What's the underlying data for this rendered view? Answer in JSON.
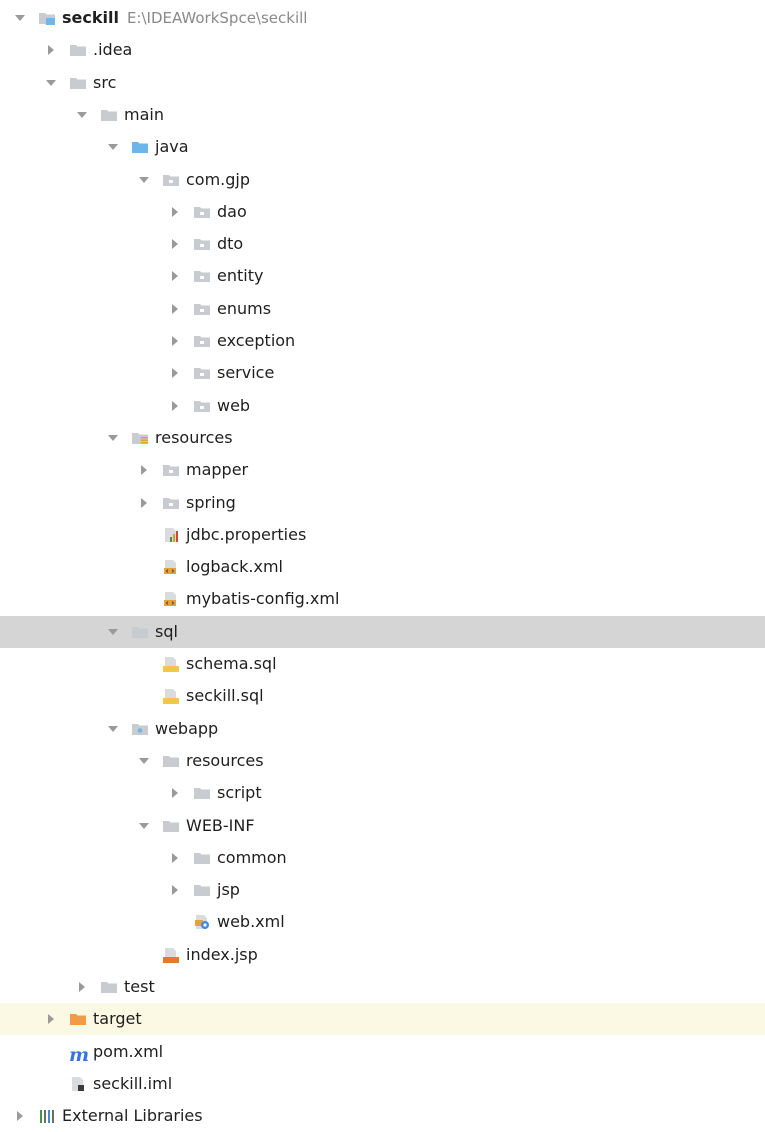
{
  "tree": {
    "root": {
      "name": "seckill",
      "path": "E:\\IDEAWorkSpce\\seckill"
    },
    "items": [
      {
        "label": "seckill",
        "level": 0,
        "arrow": "down",
        "icon": "module-folder-icon",
        "root": true
      },
      {
        "label": ".idea",
        "level": 1,
        "arrow": "right",
        "icon": "folder-icon"
      },
      {
        "label": "src",
        "level": 1,
        "arrow": "down",
        "icon": "folder-icon"
      },
      {
        "label": "main",
        "level": 2,
        "arrow": "down",
        "icon": "folder-icon"
      },
      {
        "label": "java",
        "level": 3,
        "arrow": "down",
        "icon": "source-folder-icon"
      },
      {
        "label": "com.gjp",
        "level": 4,
        "arrow": "down",
        "icon": "package-icon"
      },
      {
        "label": "dao",
        "level": 5,
        "arrow": "right",
        "icon": "package-icon"
      },
      {
        "label": "dto",
        "level": 5,
        "arrow": "right",
        "icon": "package-icon"
      },
      {
        "label": "entity",
        "level": 5,
        "arrow": "right",
        "icon": "package-icon"
      },
      {
        "label": "enums",
        "level": 5,
        "arrow": "right",
        "icon": "package-icon"
      },
      {
        "label": "exception",
        "level": 5,
        "arrow": "right",
        "icon": "package-icon"
      },
      {
        "label": "service",
        "level": 5,
        "arrow": "right",
        "icon": "package-icon"
      },
      {
        "label": "web",
        "level": 5,
        "arrow": "right",
        "icon": "package-icon"
      },
      {
        "label": "resources",
        "level": 3,
        "arrow": "down",
        "icon": "resources-folder-icon"
      },
      {
        "label": "mapper",
        "level": 4,
        "arrow": "right",
        "icon": "package-icon"
      },
      {
        "label": "spring",
        "level": 4,
        "arrow": "right",
        "icon": "package-icon"
      },
      {
        "label": "jdbc.properties",
        "level": 4,
        "arrow": "none",
        "icon": "properties-file-icon"
      },
      {
        "label": "logback.xml",
        "level": 4,
        "arrow": "none",
        "icon": "xml-file-icon"
      },
      {
        "label": "mybatis-config.xml",
        "level": 4,
        "arrow": "none",
        "icon": "xml-file-icon"
      },
      {
        "label": "sql",
        "level": 3,
        "arrow": "down",
        "icon": "folder-icon",
        "selected": true
      },
      {
        "label": "schema.sql",
        "level": 4,
        "arrow": "none",
        "icon": "sql-file-icon"
      },
      {
        "label": "seckill.sql",
        "level": 4,
        "arrow": "none",
        "icon": "sql-file-icon"
      },
      {
        "label": "webapp",
        "level": 3,
        "arrow": "down",
        "icon": "web-folder-icon"
      },
      {
        "label": "resources",
        "level": 4,
        "arrow": "down",
        "icon": "folder-icon"
      },
      {
        "label": "script",
        "level": 5,
        "arrow": "right",
        "icon": "folder-icon"
      },
      {
        "label": "WEB-INF",
        "level": 4,
        "arrow": "down",
        "icon": "folder-icon"
      },
      {
        "label": "common",
        "level": 5,
        "arrow": "right",
        "icon": "folder-icon"
      },
      {
        "label": "jsp",
        "level": 5,
        "arrow": "right",
        "icon": "folder-icon"
      },
      {
        "label": "web.xml",
        "level": 5,
        "arrow": "none",
        "icon": "webxml-file-icon"
      },
      {
        "label": "index.jsp",
        "level": 4,
        "arrow": "none",
        "icon": "jsp-file-icon"
      },
      {
        "label": "test",
        "level": 2,
        "arrow": "right",
        "icon": "folder-icon"
      },
      {
        "label": "target",
        "level": 1,
        "arrow": "right",
        "icon": "excluded-folder-icon",
        "highlight": true
      },
      {
        "label": "pom.xml",
        "level": 1,
        "arrow": "none",
        "icon": "maven-icon"
      },
      {
        "label": "seckill.iml",
        "level": 1,
        "arrow": "none",
        "icon": "iml-file-icon"
      },
      {
        "label": "External Libraries",
        "level": 0,
        "arrow": "right",
        "icon": "libraries-icon"
      }
    ],
    "sql_badge": "SQL",
    "jsp_badge": "JSP",
    "maven_letter": "m"
  },
  "colors": {
    "folder": "#c8cbd0",
    "source_folder": "#6fb6ea",
    "excluded_folder": "#f19a48",
    "resources_lines": "#d4a72c",
    "selected_row": "#d5d5d5",
    "highlight_row": "#fbf8e3",
    "path_text": "#8a8a8a",
    "arrow": "#9a9a9a",
    "maven": "#3b74d9"
  }
}
